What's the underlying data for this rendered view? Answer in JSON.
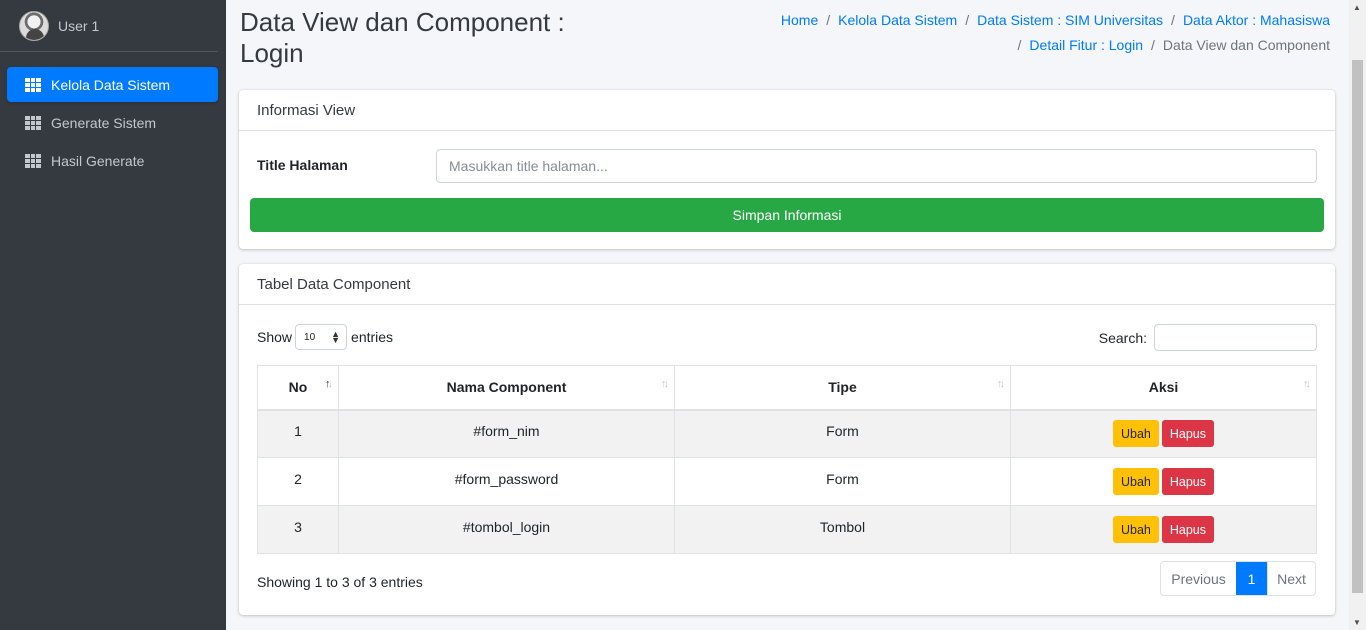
{
  "sidebar": {
    "user_name": "User 1",
    "items": [
      {
        "label": "Kelola Data Sistem",
        "active": true
      },
      {
        "label": "Generate Sistem",
        "active": false
      },
      {
        "label": "Hasil Generate",
        "active": false
      }
    ]
  },
  "header": {
    "title": "Data View dan Component : Login",
    "breadcrumb": [
      "Home",
      "Kelola Data Sistem",
      "Data Sistem : SIM Universitas",
      "Data Aktor : Mahasiswa",
      "Detail Fitur : Login",
      "Data View dan Component"
    ]
  },
  "info_card": {
    "title": "Informasi View",
    "field_label": "Title Halaman",
    "field_value": "",
    "field_placeholder": "Masukkan title halaman...",
    "save_label": "Simpan Informasi"
  },
  "table_card": {
    "title": "Tabel Data Component",
    "show_label": "Show",
    "entries_label": "entries",
    "page_length": "10",
    "search_label": "Search:",
    "search_value": "",
    "columns": [
      "No",
      "Nama Component",
      "Tipe",
      "Aksi"
    ],
    "rows": [
      {
        "no": "1",
        "name": "#form_nim",
        "type": "Form"
      },
      {
        "no": "2",
        "name": "#form_password",
        "type": "Form"
      },
      {
        "no": "3",
        "name": "#tombol_login",
        "type": "Tombol"
      }
    ],
    "edit_label": "Ubah",
    "delete_label": "Hapus",
    "info": "Showing 1 to 3 of 3 entries",
    "pagination": {
      "previous": "Previous",
      "current": "1",
      "next": "Next"
    }
  },
  "colors": {
    "sidebar_bg": "#343a40",
    "primary": "#007bff",
    "success": "#28a745",
    "warning": "#ffc107",
    "danger": "#dc3545"
  }
}
